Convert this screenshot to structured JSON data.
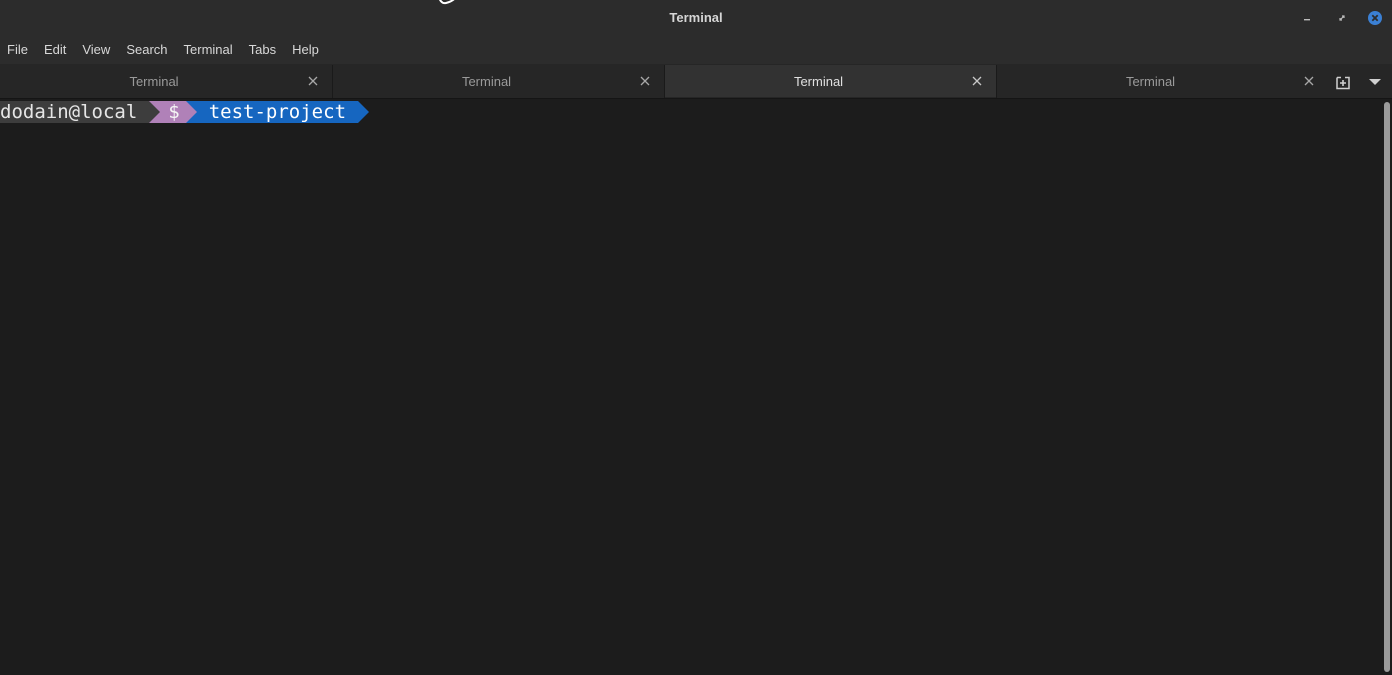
{
  "window": {
    "title": "Terminal"
  },
  "menubar": {
    "items": [
      "File",
      "Edit",
      "View",
      "Search",
      "Terminal",
      "Tabs",
      "Help"
    ]
  },
  "tabs": [
    {
      "label": "Terminal",
      "active": false
    },
    {
      "label": "Terminal",
      "active": false
    },
    {
      "label": "Terminal",
      "active": true
    },
    {
      "label": "Terminal",
      "active": false
    }
  ],
  "terminal": {
    "prompt": {
      "user": "dodain@local",
      "symbol": "$",
      "directory": "test-project"
    }
  },
  "colors": {
    "title_bg": "#2c2c2c",
    "terminal_bg": "#1c1c1c",
    "prompt_user_bg": "#3d3d3d",
    "prompt_symbol_bg": "#b081b8",
    "prompt_dir_bg": "#1666c0",
    "close_accent": "#3b80d4"
  },
  "icons": {
    "minimize": "minimize-icon",
    "maximize": "restore-icon",
    "close": "close-icon",
    "tab_close": "close-icon",
    "new_tab": "new-tab-icon",
    "tab_menu": "chevron-down-icon"
  }
}
